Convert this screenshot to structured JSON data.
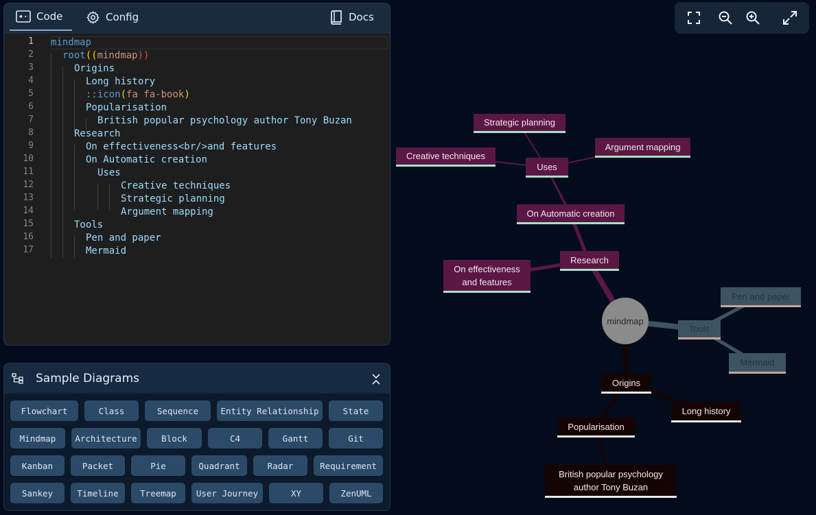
{
  "tabs": {
    "code": "Code",
    "config": "Config",
    "docs": "Docs"
  },
  "code": {
    "lines": [
      {
        "n": "1"
      },
      {
        "n": "2"
      },
      {
        "n": "3"
      },
      {
        "n": "4"
      },
      {
        "n": "5"
      },
      {
        "n": "6"
      },
      {
        "n": "7"
      },
      {
        "n": "8"
      },
      {
        "n": "9"
      },
      {
        "n": "10"
      },
      {
        "n": "11"
      },
      {
        "n": "12"
      },
      {
        "n": "13"
      },
      {
        "n": "14"
      },
      {
        "n": "15"
      },
      {
        "n": "16"
      },
      {
        "n": "17"
      }
    ],
    "t1": "mindmap",
    "t2a": "root",
    "t2b": "((",
    "t2c": "mindmap",
    "t2d": "))",
    "t3": "Origins",
    "t4": "Long history",
    "t5a": "::",
    "t5b": "icon",
    "t5c": "(",
    "t5d": "fa fa-book",
    "t5e": ")",
    "t6": "Popularisation",
    "t7": "British popular psychology author Tony Buzan",
    "t8": "Research",
    "t9": "On effectiveness<br/>and features",
    "t10": "On Automatic creation",
    "t11": "Uses",
    "t12": "Creative techniques",
    "t13": "Strategic planning",
    "t14": "Argument mapping",
    "t15": "Tools",
    "t16": "Pen and paper",
    "t17": "Mermaid"
  },
  "samples": {
    "title": "Sample Diagrams",
    "buttons": [
      "Flowchart",
      "Class",
      "Sequence",
      "Entity Relationship",
      "State",
      "Mindmap",
      "Architecture",
      "Block",
      "C4",
      "Gantt",
      "Git",
      "Kanban",
      "Packet",
      "Pie",
      "Quadrant",
      "Radar",
      "Requirement",
      "Sankey",
      "Timeline",
      "Treemap",
      "User Journey",
      "XY",
      "ZenUML"
    ]
  },
  "diagram": {
    "root": "mindmap",
    "research": "Research",
    "effectiveness_1": "On effectiveness",
    "effectiveness_2": "and features",
    "automatic": "On Automatic creation",
    "uses": "Uses",
    "creative": "Creative techniques",
    "strategic": "Strategic planning",
    "argument": "Argument mapping",
    "origins": "Origins",
    "long_history": "Long history",
    "popularisation": "Popularisation",
    "buzan_1": "British popular psychology",
    "buzan_2": "author Tony Buzan",
    "tools": "Tools",
    "pen": "Pen and paper",
    "mermaid": "Mermaid"
  },
  "colors": {
    "research_branch": "#5b1744",
    "origins_branch": "#150404",
    "tools_branch": "#3c5461",
    "root": "#8b8b8b"
  }
}
